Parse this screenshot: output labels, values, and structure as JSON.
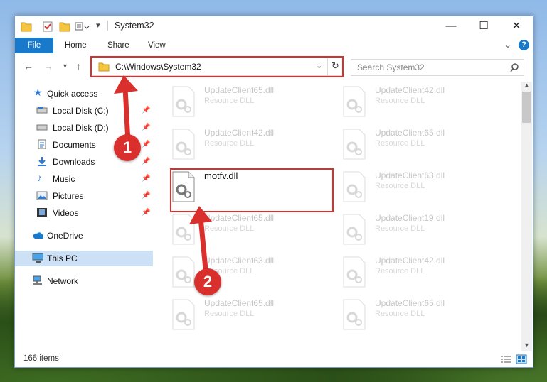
{
  "window": {
    "title": "System32"
  },
  "ribbon": {
    "tabs": [
      "File",
      "Home",
      "Share",
      "View"
    ]
  },
  "address": {
    "path": "C:\\Windows\\System32"
  },
  "search": {
    "placeholder": "Search System32"
  },
  "sidebar": {
    "quick_access": "Quick access",
    "items": [
      {
        "label": "Local Disk (C:)",
        "icon": "drive-icon"
      },
      {
        "label": "Local Disk (D:)",
        "icon": "drive-icon"
      },
      {
        "label": "Documents",
        "icon": "documents-icon"
      },
      {
        "label": "Downloads",
        "icon": "downloads-icon"
      },
      {
        "label": "Music",
        "icon": "music-icon"
      },
      {
        "label": "Pictures",
        "icon": "pictures-icon"
      },
      {
        "label": "Videos",
        "icon": "videos-icon"
      }
    ],
    "onedrive": "OneDrive",
    "thispc": "This PC",
    "network": "Network"
  },
  "files": {
    "left": [
      {
        "name": "UpdateClient65.dll",
        "type": "Resource DLL"
      },
      {
        "name": "UpdateClient42.dll",
        "type": "Resource DLL"
      },
      {
        "name": "motfv.dll",
        "type": ""
      },
      {
        "name": "UpdateClient65.dll",
        "type": "Resource DLL"
      },
      {
        "name": "UpdateClient63.dll",
        "type": "Resource DLL"
      },
      {
        "name": "UpdateClient65.dll",
        "type": "Resource DLL"
      }
    ],
    "right": [
      {
        "name": "UpdateClient42.dll",
        "type": "Resource DLL"
      },
      {
        "name": "UpdateClient65.dll",
        "type": "Resource DLL"
      },
      {
        "name": "UpdateClient63.dll",
        "type": "Resource DLL"
      },
      {
        "name": "UpdateClient19.dll",
        "type": "Resource DLL"
      },
      {
        "name": "UpdateClient42.dll",
        "type": "Resource DLL"
      },
      {
        "name": "UpdateClient65.dll",
        "type": "Resource DLL"
      }
    ]
  },
  "status": {
    "count": "166 items"
  },
  "callouts": {
    "one": "1",
    "two": "2"
  },
  "colors": {
    "accent": "#1979ca",
    "highlight": "#d9302e"
  }
}
